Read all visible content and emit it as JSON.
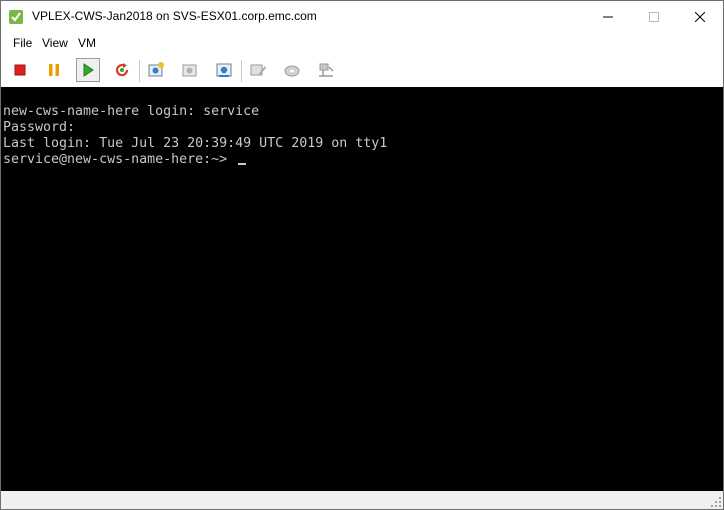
{
  "window": {
    "title": "VPLEX-CWS-Jan2018 on SVS-ESX01.corp.emc.com",
    "controls": [
      "minimize-icon",
      "maximize-icon",
      "close-icon"
    ]
  },
  "menu": {
    "items": [
      "File",
      "View",
      "VM"
    ]
  },
  "toolbar": {
    "buttons": [
      {
        "icon": "power-off-icon",
        "color": "#e02020"
      },
      {
        "icon": "suspend-icon",
        "color": "#e8a000"
      },
      {
        "icon": "power-on-icon",
        "color": "#2eaa2e",
        "active": true
      },
      {
        "icon": "reset-icon",
        "color": "#d83a2a"
      },
      {
        "icon": "snapshot-take-icon"
      },
      {
        "icon": "snapshot-revert-icon",
        "disabled": true
      },
      {
        "icon": "snapshot-manager-icon"
      },
      {
        "icon": "edit-settings-icon",
        "disabled": true
      },
      {
        "icon": "cd-dvd-icon",
        "disabled": true
      },
      {
        "icon": "network-adapter-icon",
        "disabled": true
      }
    ]
  },
  "console": {
    "lines": [
      "new-cws-name-here login: service",
      "Password:",
      "Last login: Tue Jul 23 20:39:49 UTC 2019 on tty1",
      "service@new-cws-name-here:~> "
    ]
  }
}
